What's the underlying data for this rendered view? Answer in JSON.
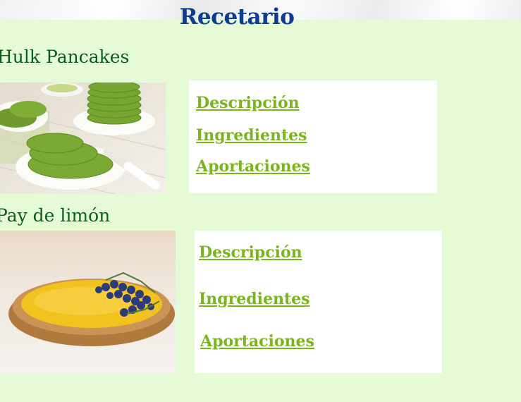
{
  "page": {
    "title": "Recetario"
  },
  "recipes": [
    {
      "name": "Hulk Pancakes",
      "links": {
        "description": "Descripción",
        "ingredients": "Ingredientes",
        "contributions": "Aportaciones"
      }
    },
    {
      "name": "Pay de limón",
      "links": {
        "description": "Descripción",
        "ingredients": "Ingredientes",
        "contributions": "Aportaciones"
      }
    }
  ],
  "colors": {
    "background": "#e4fbd6",
    "title": "#0b3d91",
    "recipe_name": "#0b5d1e",
    "link": "#7ab520"
  }
}
